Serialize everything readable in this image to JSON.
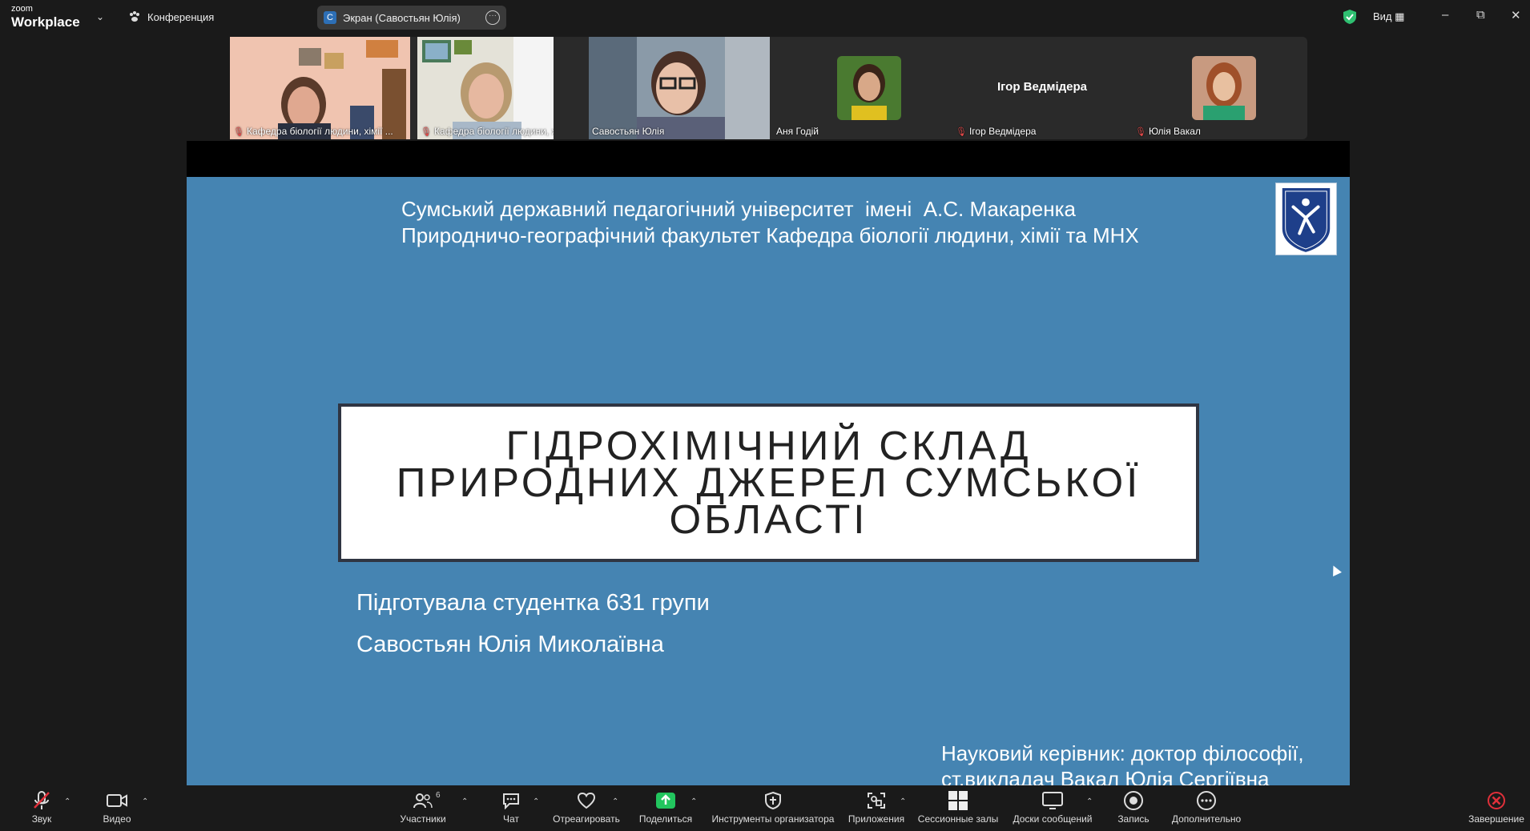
{
  "app": {
    "logo_small": "zoom",
    "logo_big": "Workplace",
    "conference_label": "Конференция",
    "share_pill": {
      "initial": "С",
      "label": "Экран (Савостьян Юлія)"
    },
    "view_label": "Вид"
  },
  "participants": [
    {
      "name": "Кафедра біології людини, хімії ...",
      "muted": true
    },
    {
      "name": "Кафедра біології людини, хімії ...",
      "muted": true
    },
    {
      "name": "Савостьян Юлія",
      "muted": false
    },
    {
      "name": "Аня Годій",
      "muted": false
    },
    {
      "name": "Ігор Ведмідера",
      "muted": true,
      "display_name": "Ігор Ведмідера"
    },
    {
      "name": "Юлія Вакал",
      "muted": true
    }
  ],
  "slide": {
    "university_line1": "Сумський державний педагогічний університет  імені  А.С. Макаренка",
    "university_line2": "Природничо-географічний факультет Кафедра біології людини, хімії та МНХ",
    "title": "ГІДРОХІМІЧНИЙ СКЛАД ПРИРОДНИХ ДЖЕРЕЛ СУМСЬКОЇ ОБЛАСТІ",
    "prepared_by": "Підготувала студентка 631 групи",
    "student_name": "Савостьян Юлія Миколаївна",
    "supervisor_line1": "Науковий керівник: доктор філософії,",
    "supervisor_line2": "ст.викладач Вакал Юлія Сергіївна"
  },
  "toolbar": {
    "audio": "Звук",
    "video": "Видео",
    "participants": "Участники",
    "participants_count": "6",
    "chat": "Чат",
    "react": "Отреагировать",
    "share": "Поделиться",
    "host_tools": "Инструменты организатора",
    "apps": "Приложения",
    "breakout": "Сессионные залы",
    "whiteboards": "Доски сообщений",
    "record": "Запись",
    "more": "Дополнительно",
    "end": "Завершение"
  },
  "colors": {
    "slide_bg": "#4584b2",
    "active_speaker": "#2fbf71",
    "share_green": "#22c55e",
    "end_red": "#e0303a"
  }
}
